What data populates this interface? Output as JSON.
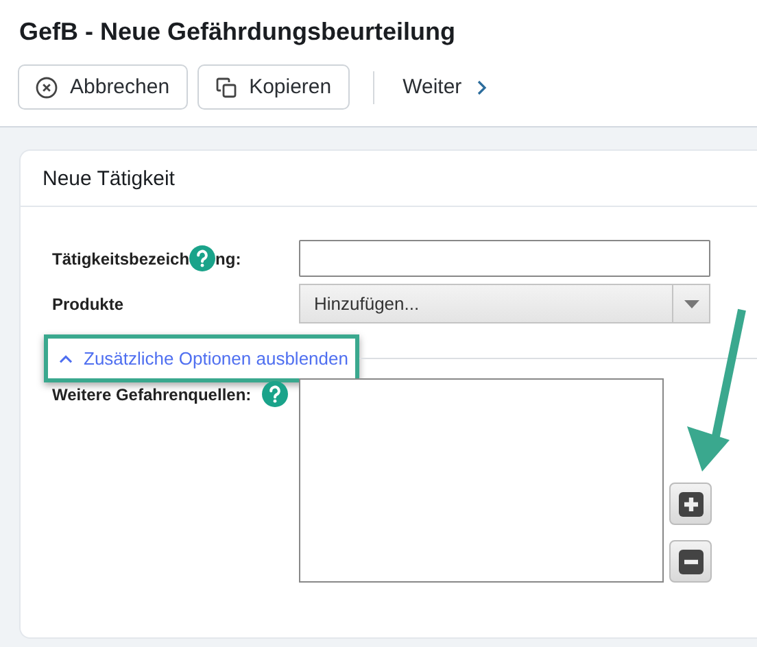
{
  "title": "GefB - Neue Gefährdungsbeurteilung",
  "toolbar": [
    {
      "kind": "cancel",
      "label": "Abbrechen"
    },
    {
      "kind": "copy",
      "label": "Kopieren"
    },
    {
      "kind": "next",
      "label": "Weiter"
    }
  ],
  "card": {
    "title": "Neue Tätigkeit",
    "fields": [
      {
        "kind": "text",
        "label": [
          "Tätigkeitsbezeich",
          "ng:"
        ],
        "help": true
      },
      {
        "kind": "select",
        "label": [
          "Produkte"
        ],
        "help": false,
        "placeholder": "Hinzufügen..."
      }
    ],
    "toggle": {
      "label": "Zusätzliche Optionen ausblenden",
      "expanded": true,
      "highlighted": true
    },
    "extra_fields": [
      {
        "kind": "list",
        "label": [
          "Weitere Gefahrenquellen:"
        ],
        "help": true
      }
    ]
  },
  "annotation_arrow": true
}
